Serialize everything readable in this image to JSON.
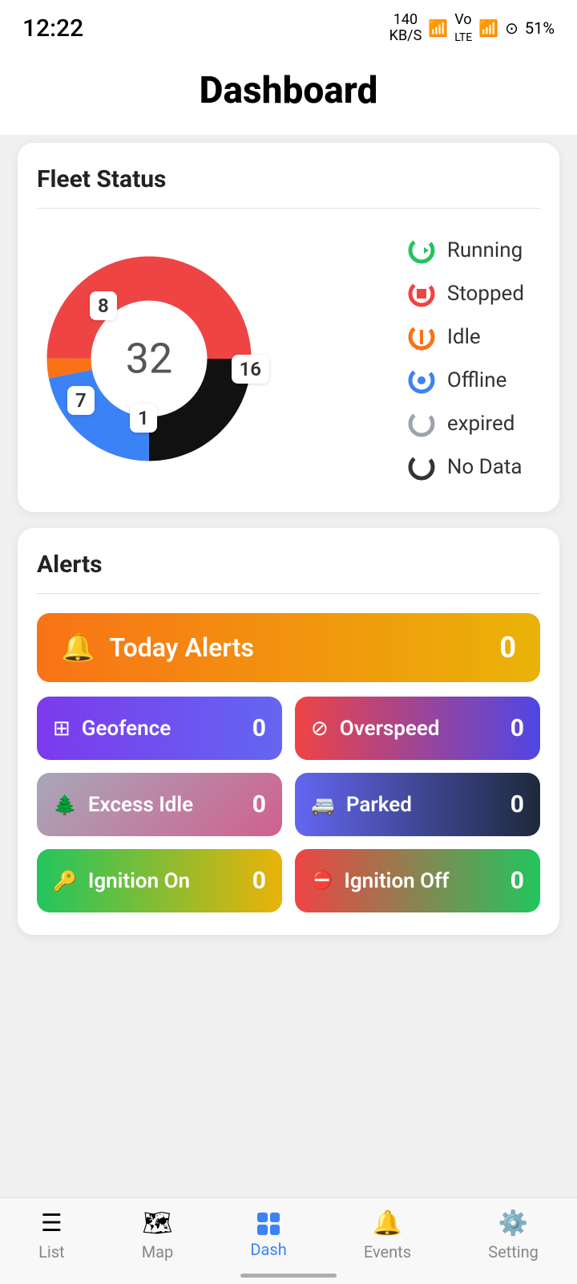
{
  "statusBar": {
    "time": "12:22",
    "dataSpeed": "140\nKB/S",
    "wifi": "WiFi",
    "lte": "Vo LTE",
    "signal": "Signal",
    "battery": "51%"
  },
  "header": {
    "title": "Dashboard"
  },
  "fleetStatus": {
    "sectionTitle": "Fleet Status",
    "totalCount": "32",
    "segments": [
      {
        "label": "Running",
        "color": "#22c55e",
        "value": 16,
        "count": "16"
      },
      {
        "label": "Stopped",
        "color": "#ef4444",
        "value": 8,
        "count": "8"
      },
      {
        "label": "Idle",
        "color": "#f97316",
        "value": 1,
        "count": "1"
      },
      {
        "label": "Offline",
        "color": "#3b82f6",
        "value": 7,
        "count": "7"
      },
      {
        "label": "expired",
        "color": "#9ca3af",
        "value": 0
      },
      {
        "label": "No Data",
        "color": "#000000",
        "value": 0
      }
    ]
  },
  "alerts": {
    "sectionTitle": "Alerts",
    "todayAlerts": {
      "label": "Today Alerts",
      "count": "0"
    },
    "buttons": [
      {
        "label": "Geofence",
        "count": "0",
        "style": "geofence"
      },
      {
        "label": "Overspeed",
        "count": "0",
        "style": "overspeed"
      },
      {
        "label": "Excess Idle",
        "count": "0",
        "style": "excess-idle"
      },
      {
        "label": "Parked",
        "count": "0",
        "style": "parked"
      },
      {
        "label": "Ignition On",
        "count": "0",
        "style": "ignition-on"
      },
      {
        "label": "Ignition Off",
        "count": "0",
        "style": "ignition-off"
      }
    ]
  },
  "bottomNav": {
    "items": [
      {
        "label": "List",
        "icon": "list",
        "active": false
      },
      {
        "label": "Map",
        "icon": "map",
        "active": false
      },
      {
        "label": "Dash",
        "icon": "dash",
        "active": true
      },
      {
        "label": "Events",
        "icon": "bell",
        "active": false
      },
      {
        "label": "Setting",
        "icon": "gear",
        "active": false
      }
    ]
  }
}
